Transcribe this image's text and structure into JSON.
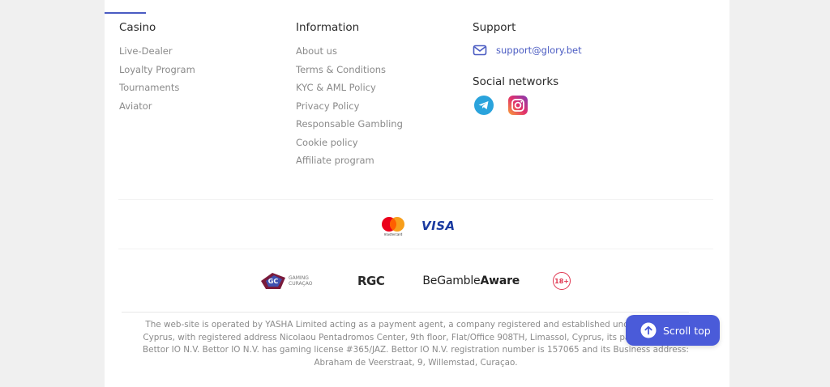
{
  "columns": {
    "casino": {
      "title": "Casino",
      "items": [
        "Live-Dealer",
        "Loyalty Program",
        "Tournaments",
        "Aviator"
      ]
    },
    "information": {
      "title": "Information",
      "items": [
        "About us",
        "Terms & Conditions",
        "KYC & AML Policy",
        "Privacy Policy",
        "Responsable Gambling",
        "Cookie policy",
        "Affiliate program"
      ]
    },
    "support": {
      "title": "Support",
      "email": "support@glory.bet",
      "social_title": "Social networks",
      "social_icons": [
        "telegram-icon",
        "instagram-icon"
      ]
    }
  },
  "payments": {
    "mastercard_label": "mastercard",
    "visa_label": "VISA"
  },
  "licenses": {
    "gaming_curacao": "GC",
    "gaming_label": "GAMING CURAÇAO",
    "rgc_label": "RGC",
    "begambleaware_prefix": "BeGamble",
    "begambleaware_suffix": "Aware",
    "age_label": "18+"
  },
  "legal_text": "The web-site is operated by YASHA Limited acting as a payment agent, a company registered and established under the laws of Cyprus, with registered address Nicolaou Pentadromos Center, 9th floor, Flat/Office 908TH, Limassol, Cyprus, its parent company Bettor IO N.V. Bettor IO N.V. has gaming license #365/JAZ. Bettor IO N.V. registration number is 157065 and its Business address: Abraham de Veerstraat, 9, Willemstad, Curaçao.",
  "scroll_top_label": "Scroll top",
  "colors": {
    "accent": "#4a5bd9",
    "link": "#4a5bc2",
    "muted_text": "#8a8a8a"
  }
}
